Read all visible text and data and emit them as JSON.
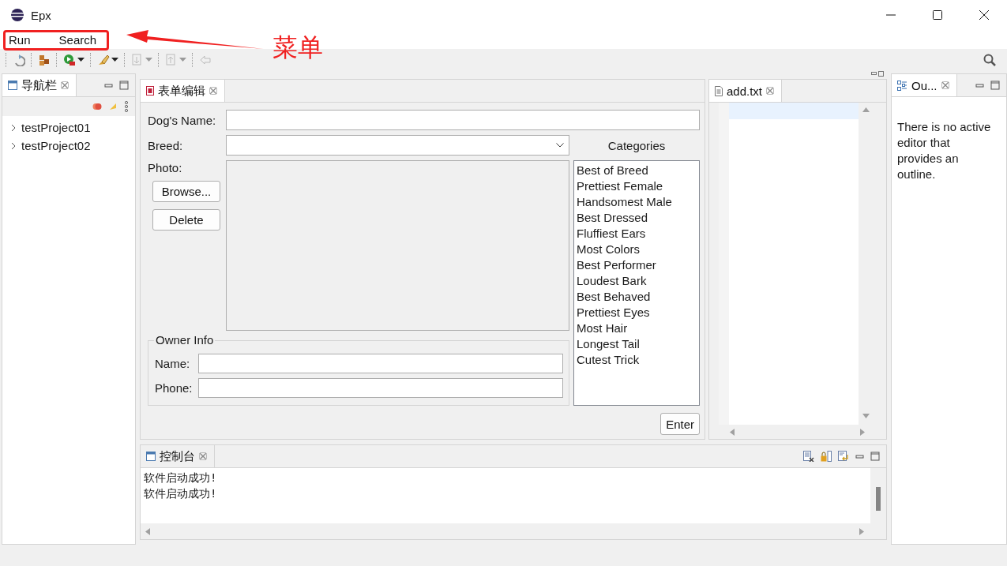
{
  "window": {
    "title": "Epx"
  },
  "menu": [
    {
      "label": "Run"
    },
    {
      "label": "Search"
    }
  ],
  "annotation": {
    "label": "菜单"
  },
  "toolbar": [
    {
      "kind": "refresh",
      "disabled": false,
      "dropdown": false
    },
    {
      "kind": "cubes",
      "disabled": false,
      "dropdown": false
    },
    {
      "kind": "run",
      "disabled": false,
      "dropdown": true
    },
    {
      "kind": "brush",
      "disabled": false,
      "dropdown": true
    },
    {
      "kind": "down",
      "disabled": true,
      "dropdown": true
    },
    {
      "kind": "up",
      "disabled": true,
      "dropdown": true
    },
    {
      "kind": "back",
      "disabled": true,
      "dropdown": false
    }
  ],
  "navigator": {
    "tab": "导航栏",
    "tree": [
      {
        "label": "testProject01",
        "expanded": false
      },
      {
        "label": "testProject02",
        "expanded": false
      }
    ]
  },
  "form_editor": {
    "tab": "表单编辑",
    "dog_name_label": "Dog's Name:",
    "breed_label": "Breed:",
    "photo_label": "Photo:",
    "buttons": [
      "Browse...",
      "Delete"
    ],
    "categories_title": "Categories",
    "categories": [
      "Best of Breed",
      "Prettiest Female",
      "Handsomest Male",
      "Best Dressed",
      "Fluffiest Ears",
      "Most Colors",
      "Best Performer",
      "Loudest Bark",
      "Best Behaved",
      "Prettiest Eyes",
      "Most Hair",
      "Longest Tail",
      "Cutest Trick"
    ],
    "owner_group": {
      "title": "Owner Info",
      "name_label": "Name:",
      "phone_label": "Phone:"
    },
    "enter_button": "Enter"
  },
  "text_editor": {
    "tab": "add.txt"
  },
  "outline": {
    "tab": "Ou...",
    "message": "There is no active editor that provides an outline."
  },
  "console": {
    "tab": "控制台",
    "lines": [
      "软件启动成功!",
      "软件启动成功!"
    ]
  }
}
